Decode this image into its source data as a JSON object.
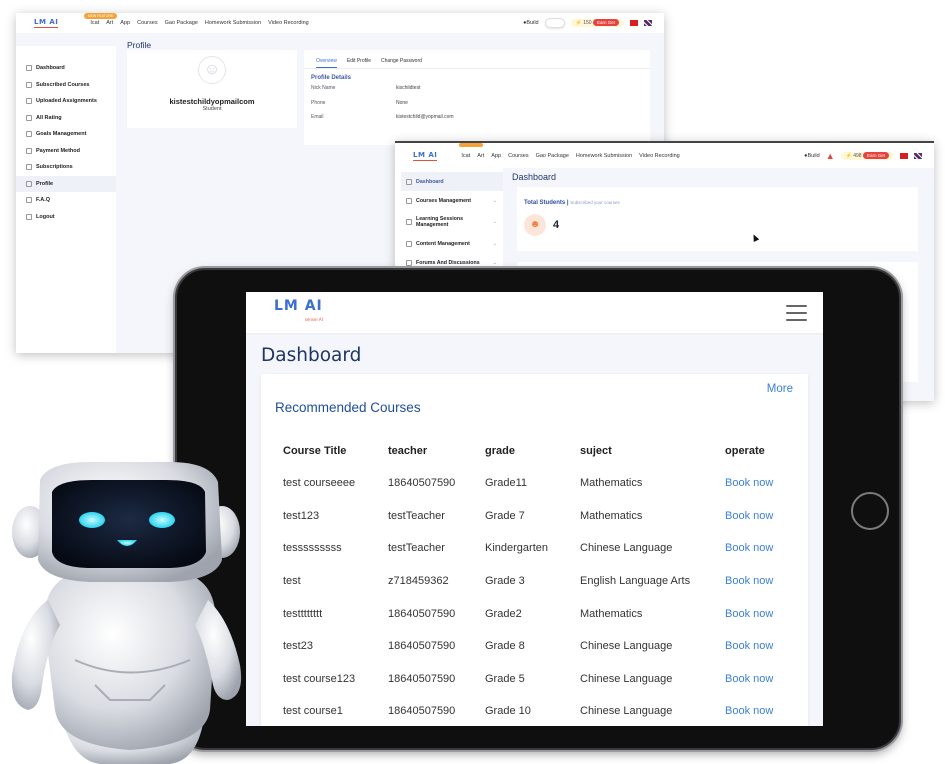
{
  "nav": {
    "items": [
      "Icat",
      "Art",
      "App",
      "Courses",
      "Gao Package",
      "Homework Submission",
      "Video Recording"
    ],
    "build_label": "Build",
    "new_badge": "NEW FEATURE"
  },
  "profile_window": {
    "points": "150",
    "earn_label": "Earn Get",
    "title": "Profile",
    "sidebar": [
      "Dashboard",
      "Subscribed Courses",
      "Uploaded Assignments",
      "All Rating",
      "Goals Management",
      "Payment Method",
      "Subscriptions",
      "Profile",
      "F.A.Q",
      "Logout"
    ],
    "active_item": "Profile",
    "username": "kistestchildyopmailcom",
    "role": "Student",
    "tabs": [
      "Overview",
      "Edit Profile",
      "Change Password"
    ],
    "details_heading": "Profile Details",
    "details": [
      {
        "key": "Nick Name",
        "value": "kischildtest"
      },
      {
        "key": "Phone",
        "value": "None"
      },
      {
        "key": "Email",
        "value": "kistestchild@yopmail.com"
      }
    ]
  },
  "teacher_window": {
    "points": "498",
    "earn_label": "Earn Get",
    "title": "Dashboard",
    "sidebar": [
      "Dashboard",
      "Courses Management",
      "Learning Sessions Management",
      "Content Management",
      "Forums And Discussions"
    ],
    "total_students_label": "Total Students",
    "total_students_sub": "Subscribed your courses",
    "total_students_value": "4"
  },
  "tablet": {
    "logo": "LM AI",
    "logo_sub": "sensei AI",
    "title": "Dashboard",
    "more_label": "More",
    "section_title": "Recommended Courses",
    "columns": [
      "Course Title",
      "teacher",
      "grade",
      "suject",
      "operate"
    ],
    "rows": [
      {
        "title": "test courseeee",
        "teacher": "18640507590",
        "grade": "Grade11",
        "subject": "Mathematics",
        "action": "Book now"
      },
      {
        "title": "test123",
        "teacher": "testTeacher",
        "grade": "Grade 7",
        "subject": "Mathematics",
        "action": "Book now"
      },
      {
        "title": "tesssssssss",
        "teacher": "testTeacher",
        "grade": "Kindergarten",
        "subject": "Chinese Language",
        "action": "Book now"
      },
      {
        "title": "test",
        "teacher": "z718459362",
        "grade": "Grade 3",
        "subject": "English Language Arts",
        "action": "Book now"
      },
      {
        "title": "testttttttt",
        "teacher": "18640507590",
        "grade": "Grade2",
        "subject": "Mathematics",
        "action": "Book now"
      },
      {
        "title": "test23",
        "teacher": "18640507590",
        "grade": "Grade 8",
        "subject": "Chinese Language",
        "action": "Book now"
      },
      {
        "title": "test course123",
        "teacher": "18640507590",
        "grade": "Grade 5",
        "subject": "Chinese Language",
        "action": "Book now"
      },
      {
        "title": "test course1",
        "teacher": "18640507590",
        "grade": "Grade 10",
        "subject": "Chinese Language",
        "action": "Book now"
      }
    ]
  },
  "colors": {
    "accent": "#3b7fd6",
    "heading": "#1e3566",
    "badge_red": "#e8423c"
  }
}
